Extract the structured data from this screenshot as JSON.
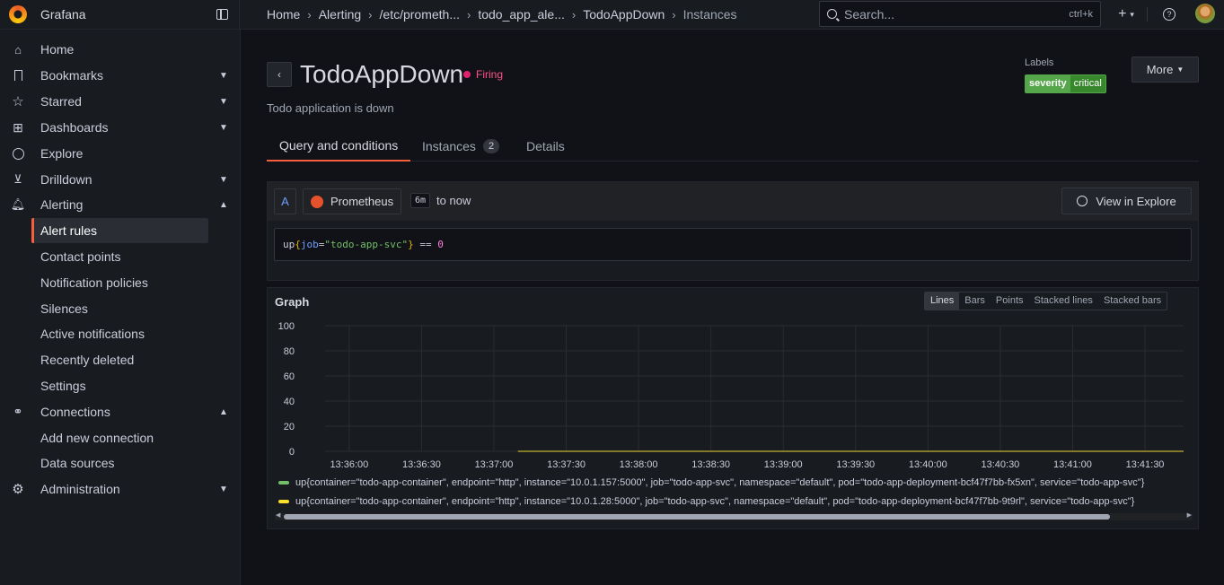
{
  "app": {
    "name": "Grafana"
  },
  "breadcrumbs": [
    "Home",
    "Alerting",
    "/etc/prometh...",
    "todo_app_ale...",
    "TodoAppDown",
    "Instances"
  ],
  "search": {
    "placeholder": "Search...",
    "shortcut": "ctrl+k"
  },
  "topbar": {
    "add_icon": "plus-icon",
    "help_icon": "help-icon"
  },
  "sidebar": {
    "items": [
      {
        "label": "Home",
        "icon": "home-icon"
      },
      {
        "label": "Bookmarks",
        "icon": "bookmark-icon",
        "expandable": true
      },
      {
        "label": "Starred",
        "icon": "star-icon",
        "expandable": true
      },
      {
        "label": "Dashboards",
        "icon": "apps-icon",
        "expandable": true
      },
      {
        "label": "Explore",
        "icon": "compass-icon"
      },
      {
        "label": "Drilldown",
        "icon": "drilldown-icon",
        "expandable": true
      },
      {
        "label": "Alerting",
        "icon": "bell-icon",
        "expanded": true
      },
      {
        "label": "Alert rules",
        "active": true
      },
      {
        "label": "Contact points"
      },
      {
        "label": "Notification policies"
      },
      {
        "label": "Silences"
      },
      {
        "label": "Active notifications"
      },
      {
        "label": "Recently deleted"
      },
      {
        "label": "Settings"
      },
      {
        "label": "Connections",
        "icon": "connections-icon",
        "expanded": true
      },
      {
        "label": "Add new connection"
      },
      {
        "label": "Data sources"
      },
      {
        "label": "Administration",
        "icon": "cog-icon",
        "expandable": true
      }
    ]
  },
  "rule": {
    "title": "TodoAppDown",
    "state": "Firing",
    "state_color": "#e0226e",
    "description": "Todo application is down",
    "labels_heading": "Labels",
    "labels": [
      {
        "key": "severity",
        "value": "critical"
      }
    ],
    "more_label": "More"
  },
  "tabs": [
    {
      "label": "Query and conditions",
      "active": true
    },
    {
      "label": "Instances",
      "count": "2"
    },
    {
      "label": "Details"
    }
  ],
  "query": {
    "ref": "A",
    "datasource": "Prometheus",
    "time_badge": "6m",
    "time_to": "to now",
    "explore_label": "View in Explore",
    "expr": {
      "fn": "up",
      "open": "{",
      "label": "job",
      "eq": "=",
      "value": "\"todo-app-svc\"",
      "close": "}",
      "op": " == ",
      "num": "0"
    }
  },
  "graph": {
    "title": "Graph",
    "modes": [
      "Lines",
      "Bars",
      "Points",
      "Stacked lines",
      "Stacked bars"
    ],
    "active_mode": "Lines",
    "legend": [
      {
        "color": "#73bf69",
        "text": "up{container=\"todo-app-container\", endpoint=\"http\", instance=\"10.0.1.157:5000\", job=\"todo-app-svc\", namespace=\"default\", pod=\"todo-app-deployment-bcf47f7bb-fx5xn\", service=\"todo-app-svc\"}"
      },
      {
        "color": "#fade2a",
        "text": "up{container=\"todo-app-container\", endpoint=\"http\", instance=\"10.0.1.28:5000\", job=\"todo-app-svc\", namespace=\"default\", pod=\"todo-app-deployment-bcf47f7bb-9t9rl\", service=\"todo-app-svc\"}"
      }
    ]
  },
  "chart_data": {
    "type": "line",
    "title": "Graph",
    "xlabel": "",
    "ylabel": "",
    "ylim": [
      0,
      100
    ],
    "yticks": [
      0,
      20,
      40,
      60,
      80,
      100
    ],
    "xticks": [
      "13:36:00",
      "13:36:30",
      "13:37:00",
      "13:37:30",
      "13:38:00",
      "13:38:30",
      "13:39:00",
      "13:39:30",
      "13:40:00",
      "13:40:30",
      "13:41:00",
      "13:41:30"
    ],
    "xlim": [
      "13:35:50",
      "13:41:46"
    ],
    "grid": true,
    "series": [
      {
        "name": "up{container=\"todo-app-container\", endpoint=\"http\", instance=\"10.0.1.157:5000\", job=\"todo-app-svc\", namespace=\"default\", pod=\"todo-app-deployment-bcf47f7bb-fx5xn\", service=\"todo-app-svc\"}",
        "color": "#73bf69",
        "x": [
          "13:37:10",
          "13:41:46"
        ],
        "values": [
          0,
          0
        ]
      },
      {
        "name": "up{container=\"todo-app-container\", endpoint=\"http\", instance=\"10.0.1.28:5000\", job=\"todo-app-svc\", namespace=\"default\", pod=\"todo-app-deployment-bcf47f7bb-9t9rl\", service=\"todo-app-svc\"}",
        "color": "#fade2a",
        "x": [
          "13:37:10",
          "13:41:46"
        ],
        "values": [
          0,
          0
        ]
      }
    ]
  }
}
